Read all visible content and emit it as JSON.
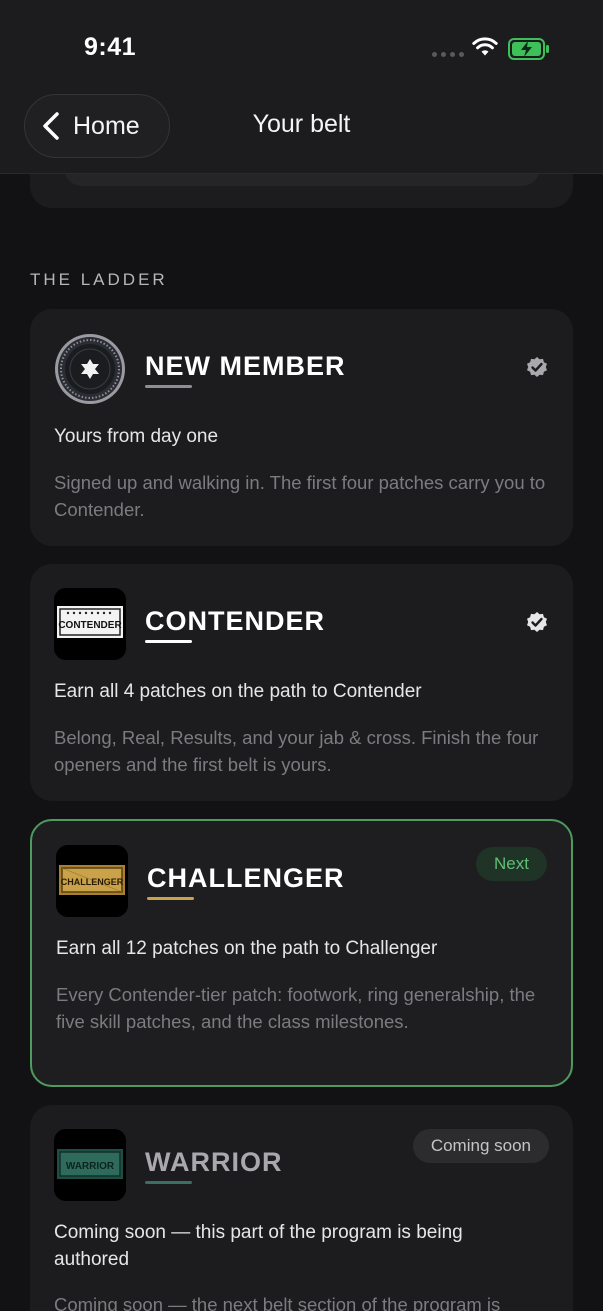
{
  "status": {
    "time": "9:41"
  },
  "nav": {
    "back_label": "Home",
    "title": "Your belt"
  },
  "section_label": "THE LADDER",
  "cards": [
    {
      "title": "NEW MEMBER",
      "lead": "Yours from day one",
      "desc": "Signed up and walking in. The first four patches carry you to Contender.",
      "status": "completed",
      "icon": "checkmark-seal-icon"
    },
    {
      "title": "CONTENDER",
      "badge_text": "CONTENDER",
      "lead": "Earn all 4 patches on the path to Contender",
      "desc": "Belong, Real, Results, and your jab & cross. Finish the four openers and the first belt is yours.",
      "status": "completed",
      "icon": "checkmark-seal-icon"
    },
    {
      "title": "CHALLENGER",
      "badge_text": "CHALLENGER",
      "pill": "Next",
      "lead": "Earn all 12 patches on the path to Challenger",
      "desc": "Every Contender-tier patch: footwork, ring generalship, the five skill patches, and the class milestones."
    },
    {
      "title": "WARRIOR",
      "badge_text": "WARRIOR",
      "pill": "Coming soon",
      "lead": "Coming soon — this part of the program is being authored",
      "desc": "Coming soon — the next belt section of the program is"
    }
  ],
  "colors": {
    "background": "#121214",
    "card": "#1c1c1e",
    "accent_green": "#4f9a5e",
    "contender_underline": "#ffffff",
    "challenger_underline": "#c9a24a",
    "warrior_underline": "#3c6e62",
    "new_member_underline": "#8e8e93"
  }
}
